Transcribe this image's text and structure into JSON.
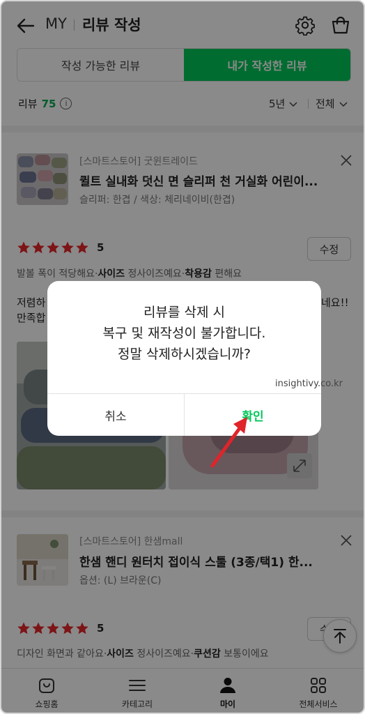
{
  "header": {
    "section": "MY",
    "title": "리뷰 작성"
  },
  "tabs": [
    {
      "label": "작성 가능한 리뷰",
      "active": false
    },
    {
      "label": "내가 작성한 리뷰",
      "active": true
    }
  ],
  "summary": {
    "label": "리뷰",
    "count": "75",
    "info_icon": "i",
    "period_filter": "5년",
    "type_filter": "전체"
  },
  "reviews": [
    {
      "store": "[스마트스토어] 굿윈트레이드",
      "product": "퀼트 실내화 덧신 면 슬리퍼 천 거실화 어린이...",
      "option": "슬리퍼: 한겹 / 색상: 체리네이비(한겹)",
      "rating": 5,
      "rating_text": "5",
      "edit_label": "수정",
      "attrs": [
        {
          "key": "발볼",
          "value": "폭이 적당해요"
        },
        {
          "key": "사이즈",
          "value": "정사이즈예요"
        },
        {
          "key": "착용감",
          "value": "편해요"
        }
      ],
      "text_line1": "저렴하",
      "text_line1_tail": "네요!!",
      "text_line2": "만족합"
    },
    {
      "store": "[스마트스토어] 한샘mall",
      "product": "한샘 핸디 원터치 접이식 스툴 (3종/택1) 한...",
      "option": "옵션: (L) 브라운(C)",
      "rating": 5,
      "rating_text": "5",
      "edit_label": "수정",
      "attrs": [
        {
          "key": "디자인",
          "value": "화면과 같아요"
        },
        {
          "key": "사이즈",
          "value": "정사이즈예요"
        },
        {
          "key": "쿠션감",
          "value": "보통이에요"
        }
      ]
    }
  ],
  "bottom_nav": [
    {
      "label": "쇼핑홈",
      "icon": "shopping-home-icon"
    },
    {
      "label": "카테고리",
      "icon": "menu-icon"
    },
    {
      "label": "마이",
      "icon": "person-icon",
      "active": true
    },
    {
      "label": "전체서비스",
      "icon": "grid-icon"
    }
  ],
  "dialog": {
    "line1": "리뷰를 삭제 시",
    "line2": "복구 및 재작성이 불가합니다.",
    "line3": "정말 삭제하시겠습니까?",
    "cancel_label": "취소",
    "confirm_label": "확인"
  },
  "watermark": "insightivy.co.kr",
  "colors": {
    "accent": "#03c75a",
    "star": "#e8262a",
    "annotation_arrow": "#e0242a"
  }
}
